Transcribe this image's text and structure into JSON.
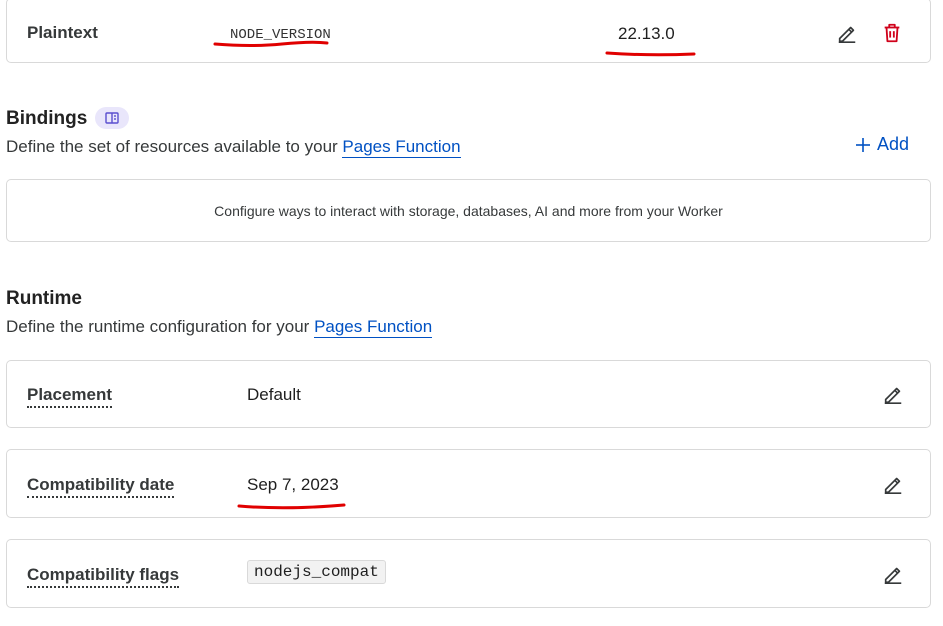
{
  "env_var": {
    "type": "Plaintext",
    "name": "NODE_VERSION",
    "value": "22.13.0",
    "edit_icon": "pencil-icon",
    "delete_icon": "trash-icon"
  },
  "bindings": {
    "title": "Bindings",
    "badge_icon": "book-icon",
    "description": "Define the set of resources available to your ",
    "link": "Pages Function",
    "add_label": "Add",
    "add_icon": "plus-icon",
    "empty_message": "Configure ways to interact with storage, databases, AI and more from your Worker"
  },
  "runtime": {
    "title": "Runtime",
    "description": "Define the runtime configuration for your ",
    "link": "Pages Function",
    "rows": [
      {
        "label": "Placement",
        "value": "Default"
      },
      {
        "label": "Compatibility date",
        "value": "Sep 7, 2023"
      },
      {
        "label": "Compatibility flags",
        "value": "nodejs_compat"
      }
    ]
  },
  "colors": {
    "link": "#0051c3",
    "danger": "#d0021b",
    "annotation": "#e00000",
    "badge_bg": "#e9e6fb"
  }
}
